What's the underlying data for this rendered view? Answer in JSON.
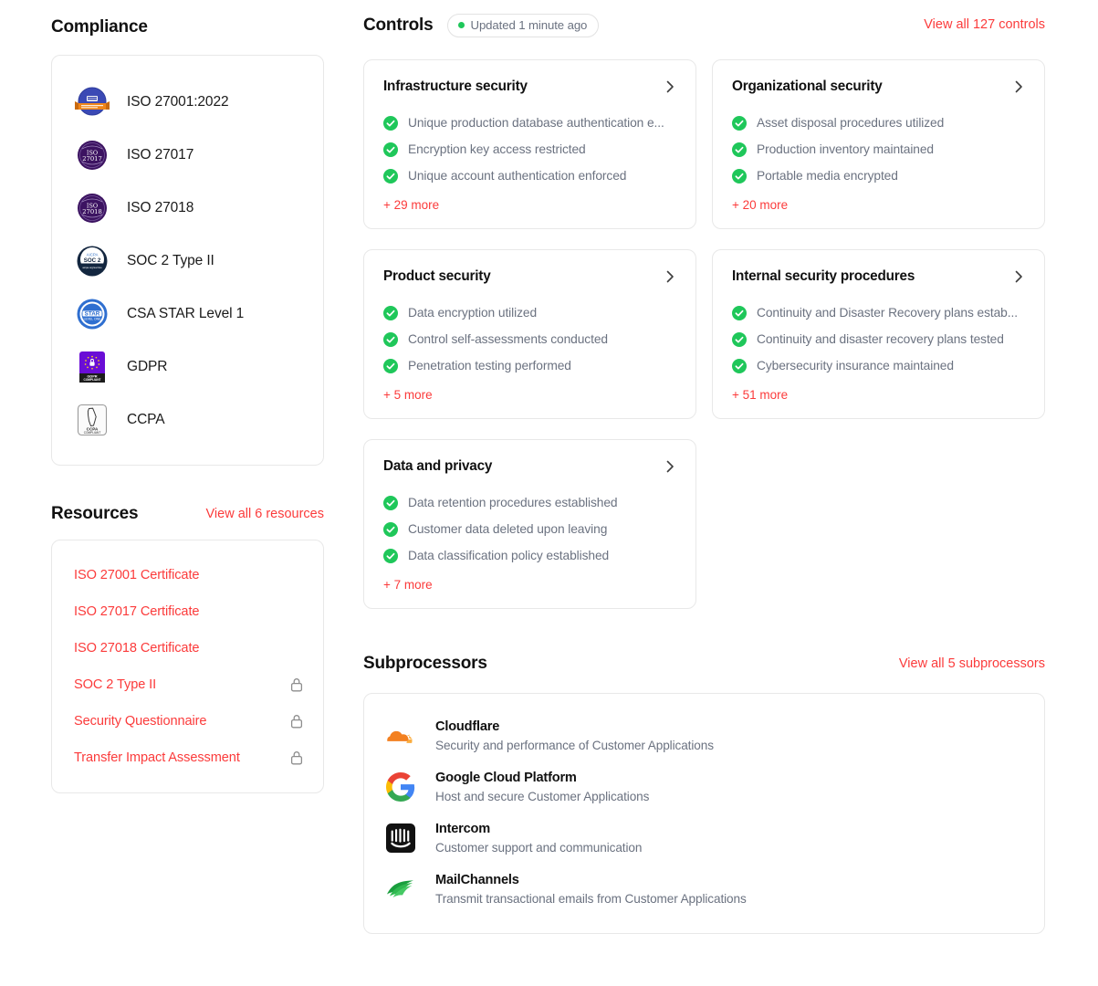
{
  "colors": {
    "accent_red": "#fb3b3b",
    "check_green": "#1fc75a",
    "status_dot_green": "#1fc75a",
    "muted_text": "#6b7280",
    "card_border": "#e8e8e8"
  },
  "compliance": {
    "title": "Compliance",
    "items": [
      {
        "label": "ISO 27001:2022",
        "icon": "iso-27001-badge-icon"
      },
      {
        "label": "ISO 27017",
        "icon": "iso-27017-badge-icon"
      },
      {
        "label": "ISO 27018",
        "icon": "iso-27018-badge-icon"
      },
      {
        "label": "SOC 2 Type II",
        "icon": "aicpa-soc2-badge-icon"
      },
      {
        "label": "CSA STAR Level 1",
        "icon": "csa-star-badge-icon"
      },
      {
        "label": "GDPR",
        "icon": "gdpr-compliant-badge-icon"
      },
      {
        "label": "CCPA",
        "icon": "ccpa-compliant-badge-icon"
      }
    ]
  },
  "resources": {
    "title": "Resources",
    "view_all": "View all 6 resources",
    "items": [
      {
        "label": "ISO 27001 Certificate",
        "locked": false
      },
      {
        "label": "ISO 27017 Certificate",
        "locked": false
      },
      {
        "label": "ISO 27018 Certificate",
        "locked": false
      },
      {
        "label": "SOC 2 Type II",
        "locked": true
      },
      {
        "label": "Security Questionnaire",
        "locked": true
      },
      {
        "label": "Transfer Impact Assessment",
        "locked": true
      }
    ]
  },
  "controls": {
    "title": "Controls",
    "status_badge": "Updated 1 minute ago",
    "view_all": "View all 127 controls",
    "cards": [
      {
        "title": "Infrastructure security",
        "items": [
          "Unique production database authentication e...",
          "Encryption key access restricted",
          "Unique account authentication enforced"
        ],
        "more": "+ 29 more"
      },
      {
        "title": "Organizational security",
        "items": [
          "Asset disposal procedures utilized",
          "Production inventory maintained",
          "Portable media encrypted"
        ],
        "more": "+ 20 more"
      },
      {
        "title": "Product security",
        "items": [
          "Data encryption utilized",
          "Control self-assessments conducted",
          "Penetration testing performed"
        ],
        "more": "+ 5 more"
      },
      {
        "title": "Internal security procedures",
        "items": [
          "Continuity and Disaster Recovery plans estab...",
          "Continuity and disaster recovery plans tested",
          "Cybersecurity insurance maintained"
        ],
        "more": "+ 51 more"
      },
      {
        "title": "Data and privacy",
        "items": [
          "Data retention procedures established",
          "Customer data deleted upon leaving",
          "Data classification policy established"
        ],
        "more": "+ 7 more"
      }
    ]
  },
  "subprocessors": {
    "title": "Subprocessors",
    "view_all": "View all 5 subprocessors",
    "items": [
      {
        "name": "Cloudflare",
        "desc": "Security and performance of Customer Applications",
        "icon": "cloudflare-logo-icon"
      },
      {
        "name": "Google Cloud Platform",
        "desc": "Host and secure Customer Applications",
        "icon": "google-logo-icon"
      },
      {
        "name": "Intercom",
        "desc": "Customer support and communication",
        "icon": "intercom-logo-icon"
      },
      {
        "name": "MailChannels",
        "desc": "Transmit transactional emails from Customer Applications",
        "icon": "mailchannels-logo-icon"
      }
    ]
  }
}
